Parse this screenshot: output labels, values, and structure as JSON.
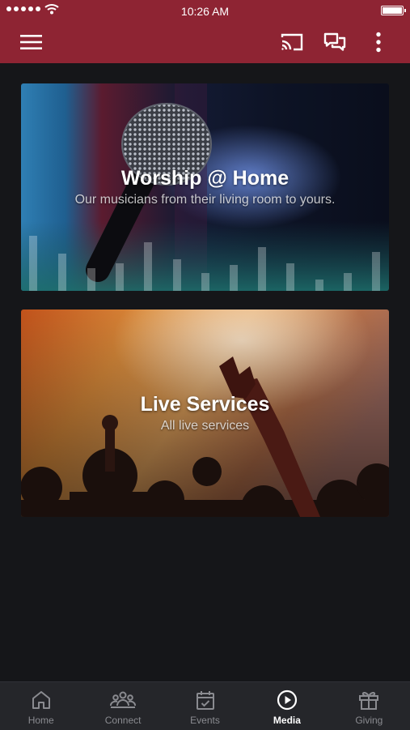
{
  "status_bar": {
    "time": "10:26 AM"
  },
  "app_bar": {
    "menu_icon": "hamburger-menu-icon",
    "actions": [
      "cast-icon",
      "chat-icon",
      "more-vertical-icon"
    ]
  },
  "cards": [
    {
      "title": "Worship @ Home",
      "subtitle": "Our musicians from their living room to yours."
    },
    {
      "title": "Live Services",
      "subtitle": "All live services"
    }
  ],
  "tabs": [
    {
      "label": "Home",
      "icon": "home-icon"
    },
    {
      "label": "Connect",
      "icon": "people-icon"
    },
    {
      "label": "Events",
      "icon": "calendar-check-icon"
    },
    {
      "label": "Media",
      "icon": "play-circle-icon",
      "active": true
    },
    {
      "label": "Giving",
      "icon": "gift-icon"
    }
  ],
  "colors": {
    "brand": "#8e2433",
    "background": "#151619",
    "tabbar": "#25262a"
  }
}
